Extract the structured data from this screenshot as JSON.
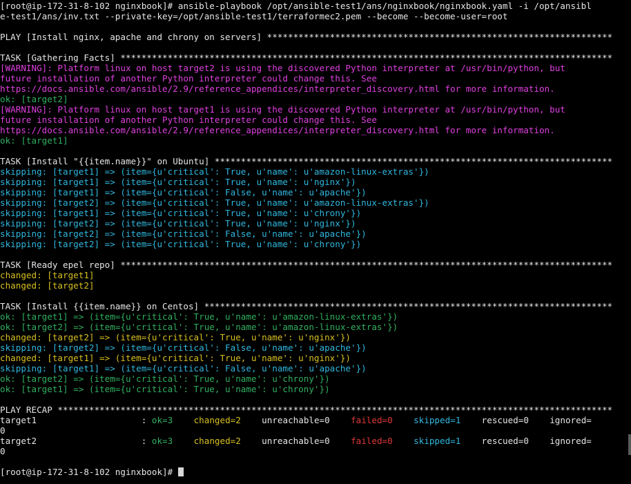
{
  "colors": {
    "default": "#e6e6e6",
    "warning": "#e040e0",
    "ok": "#30b060",
    "skipping": "#30b8e0",
    "changed": "#d8c020",
    "failed": "#e03838",
    "background": "#000000",
    "cursor": "#d8d8d8"
  },
  "lines": [
    [
      {
        "text": "[root@ip-172-31-8-102 nginxbook]# ansible-playbook /opt/ansible-test1/ans/nginxbook/nginxbook.yaml -i /opt/ansibl",
        "color": "default"
      }
    ],
    [
      {
        "text": "e-test1/ans/inv.txt --private-key=/opt/ansible-test1/terraformec2.pem --become --become-user=root",
        "color": "default"
      }
    ],
    [],
    [
      {
        "text": "PLAY [Install nginx, apache and chrony on servers] ******************************************************************",
        "color": "default"
      }
    ],
    [],
    [
      {
        "text": "TASK [Gathering Facts] **********************************************************************************************",
        "color": "default"
      }
    ],
    [
      {
        "text": "[WARNING]: Platform linux on host target2 is using the discovered Python interpreter at /usr/bin/python, but",
        "color": "warning"
      }
    ],
    [
      {
        "text": "future installation of another Python interpreter could change this. See",
        "color": "warning"
      }
    ],
    [
      {
        "text": "https://docs.ansible.com/ansible/2.9/reference_appendices/interpreter_discovery.html for more information.",
        "color": "warning"
      }
    ],
    [
      {
        "text": "ok: [target2]",
        "color": "ok"
      }
    ],
    [
      {
        "text": "[WARNING]: Platform linux on host target1 is using the discovered Python interpreter at /usr/bin/python, but",
        "color": "warning"
      }
    ],
    [
      {
        "text": "future installation of another Python interpreter could change this. See",
        "color": "warning"
      }
    ],
    [
      {
        "text": "https://docs.ansible.com/ansible/2.9/reference_appendices/interpreter_discovery.html for more information.",
        "color": "warning"
      }
    ],
    [
      {
        "text": "ok: [target1]",
        "color": "ok"
      }
    ],
    [],
    [
      {
        "text": "TASK [Install \"{{item.name}}\" on Ubuntu] ****************************************************************************",
        "color": "default"
      }
    ],
    [
      {
        "text": "skipping: [target1] => (item={u'critical': True, u'name': u'amazon-linux-extras'})",
        "color": "skipping"
      }
    ],
    [
      {
        "text": "skipping: [target1] => (item={u'critical': True, u'name': u'nginx'})",
        "color": "skipping"
      }
    ],
    [
      {
        "text": "skipping: [target1] => (item={u'critical': False, u'name': u'apache'})",
        "color": "skipping"
      }
    ],
    [
      {
        "text": "skipping: [target2] => (item={u'critical': True, u'name': u'amazon-linux-extras'})",
        "color": "skipping"
      }
    ],
    [
      {
        "text": "skipping: [target1] => (item={u'critical': True, u'name': u'chrony'})",
        "color": "skipping"
      }
    ],
    [
      {
        "text": "skipping: [target2] => (item={u'critical': True, u'name': u'nginx'})",
        "color": "skipping"
      }
    ],
    [
      {
        "text": "skipping: [target2] => (item={u'critical': False, u'name': u'apache'})",
        "color": "skipping"
      }
    ],
    [
      {
        "text": "skipping: [target2] => (item={u'critical': True, u'name': u'chrony'})",
        "color": "skipping"
      }
    ],
    [],
    [
      {
        "text": "TASK [Ready epel repo] **********************************************************************************************",
        "color": "default"
      }
    ],
    [
      {
        "text": "changed: [target1]",
        "color": "changed"
      }
    ],
    [
      {
        "text": "changed: [target2]",
        "color": "changed"
      }
    ],
    [],
    [
      {
        "text": "TASK [Install {{item.name}} on Centos] ******************************************************************************",
        "color": "default"
      }
    ],
    [
      {
        "text": "ok: [target1] => (item={u'critical': True, u'name': u'amazon-linux-extras'})",
        "color": "ok"
      }
    ],
    [
      {
        "text": "ok: [target2] => (item={u'critical': True, u'name': u'amazon-linux-extras'})",
        "color": "ok"
      }
    ],
    [
      {
        "text": "changed: [target2] => (item={u'critical': True, u'name': u'nginx'})",
        "color": "changed"
      }
    ],
    [
      {
        "text": "skipping: [target2] => (item={u'critical': False, u'name': u'apache'})",
        "color": "skipping"
      }
    ],
    [
      {
        "text": "changed: [target1] => (item={u'critical': True, u'name': u'nginx'})",
        "color": "changed"
      }
    ],
    [
      {
        "text": "skipping: [target1] => (item={u'critical': False, u'name': u'apache'})",
        "color": "skipping"
      }
    ],
    [
      {
        "text": "ok: [target2] => (item={u'critical': True, u'name': u'chrony'})",
        "color": "ok"
      }
    ],
    [
      {
        "text": "ok: [target1] => (item={u'critical': True, u'name': u'chrony'})",
        "color": "ok"
      }
    ],
    [],
    [
      {
        "text": "PLAY RECAP **********************************************************************************************************",
        "color": "default"
      }
    ],
    [
      {
        "text": "target1                    : ",
        "color": "default"
      },
      {
        "text": "ok=3",
        "color": "ok"
      },
      {
        "text": "    ",
        "color": "default"
      },
      {
        "text": "changed=2",
        "color": "changed"
      },
      {
        "text": "    unreachable=0    ",
        "color": "default"
      },
      {
        "text": "failed=0",
        "color": "failed"
      },
      {
        "text": "    ",
        "color": "default"
      },
      {
        "text": "skipped=1",
        "color": "skipping"
      },
      {
        "text": "    rescued=0    ignored=",
        "color": "default"
      }
    ],
    [
      {
        "text": "0",
        "color": "default"
      }
    ],
    [
      {
        "text": "target2                    : ",
        "color": "default"
      },
      {
        "text": "ok=3",
        "color": "ok"
      },
      {
        "text": "    ",
        "color": "default"
      },
      {
        "text": "changed=2",
        "color": "changed"
      },
      {
        "text": "    unreachable=0    ",
        "color": "default"
      },
      {
        "text": "failed=0",
        "color": "failed"
      },
      {
        "text": "    ",
        "color": "default"
      },
      {
        "text": "skipped=1",
        "color": "skipping"
      },
      {
        "text": "    rescued=0    ignored=",
        "color": "default"
      }
    ],
    [
      {
        "text": "0",
        "color": "default"
      }
    ],
    [],
    [
      {
        "text": "[root@ip-172-31-8-102 nginxbook]# ",
        "color": "default"
      }
    ]
  ]
}
